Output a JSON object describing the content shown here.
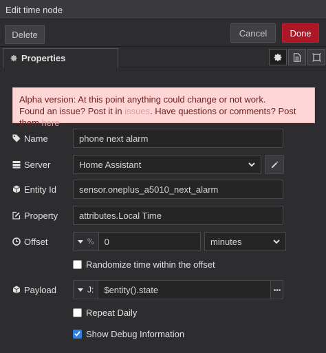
{
  "window": {
    "title": "Edit time node"
  },
  "toolbar": {
    "delete_label": "Delete",
    "cancel_label": "Cancel",
    "done_label": "Done"
  },
  "tabs": {
    "properties_label": "Properties",
    "icons": [
      "gear-icon",
      "document-icon",
      "frame-icon"
    ]
  },
  "alert": {
    "line1": "Alpha version: At this point anything could change or not work.",
    "line2_prefix": "Found an issue? Post it in ",
    "issues_link": "issues",
    "line2_middle": ". Have questions or comments? Post them ",
    "here_link": "here",
    "line2_suffix": "."
  },
  "form": {
    "name": {
      "label": "Name",
      "value": "phone next alarm"
    },
    "server": {
      "label": "Server",
      "value": "Home Assistant"
    },
    "entity_id": {
      "label": "Entity Id",
      "value": "sensor.oneplus_a5010_next_alarm"
    },
    "property": {
      "label": "Property",
      "value": "attributes.Local Time"
    },
    "offset": {
      "label": "Offset",
      "type_glyph": "⁰⁄₉",
      "value": "0",
      "unit": "minutes"
    },
    "randomize": {
      "label": "Randomize time within the offset",
      "checked": false
    },
    "payload": {
      "label": "Payload",
      "type_glyph": "J:",
      "value": "$entity().state"
    },
    "repeat_daily": {
      "label": "Repeat Daily",
      "checked": false
    },
    "debug": {
      "label": "Show Debug Information",
      "checked": true
    }
  },
  "colors": {
    "done": "#ad1625",
    "alert_bg": "#ffd6d6",
    "checkbox_checked": "#2f7fe6"
  }
}
